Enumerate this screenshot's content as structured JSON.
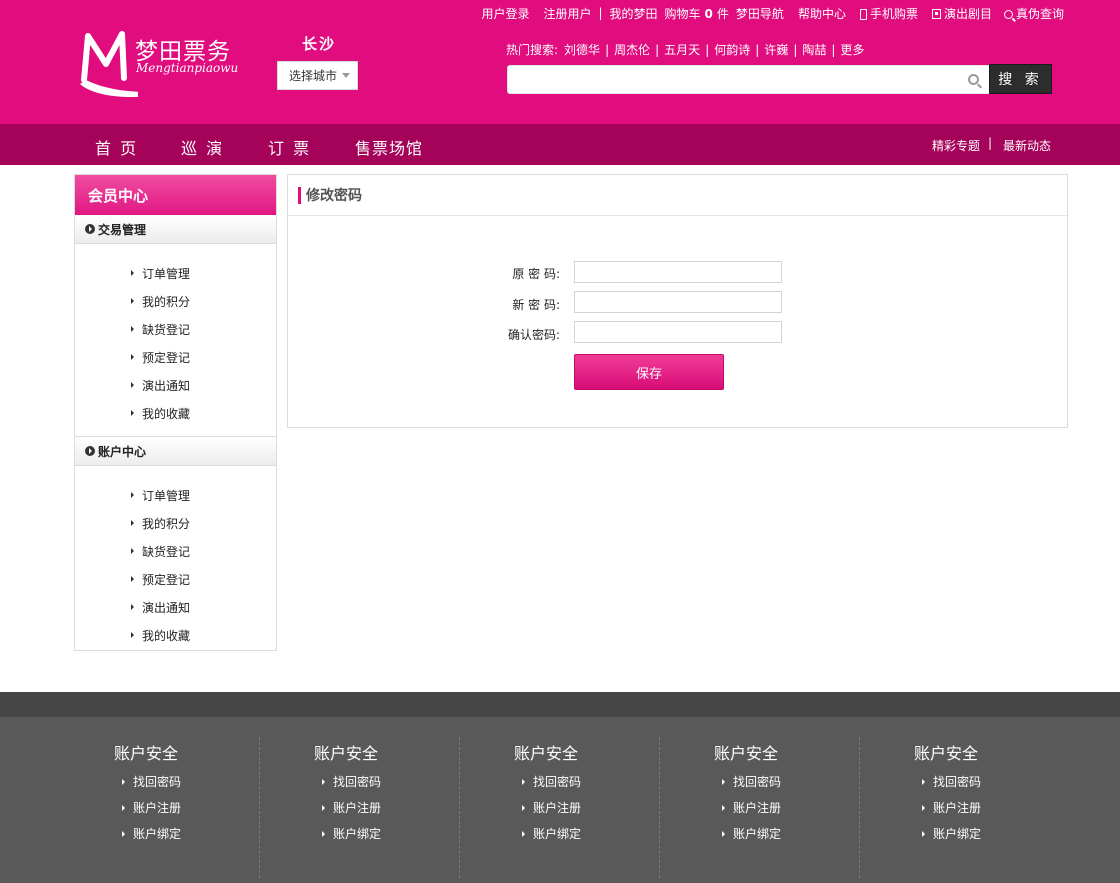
{
  "topnav": {
    "login": "用户登录",
    "register": "注册用户",
    "sep": "|",
    "my_account": "我的梦田",
    "cart_label": "购物车",
    "cart_count": "0",
    "cart_unit": "件",
    "site_nav": "梦田导航",
    "help": "帮助中心",
    "mobile": "手机购票",
    "repertoire": "演出剧目",
    "verify": "真伪查询"
  },
  "logo": {
    "cn": "梦田票务",
    "en": "Mengtianpiaowu"
  },
  "city": {
    "name": "长沙",
    "select_label": "选择城市"
  },
  "hot_search": {
    "label": "热门搜索:",
    "items": [
      "刘德华",
      "周杰伦",
      "五月天",
      "何韵诗",
      "许巍",
      "陶喆",
      "更多"
    ]
  },
  "search": {
    "placeholder": "",
    "button_label": "搜 索"
  },
  "mainnav": {
    "items": [
      "首 页",
      "巡 演",
      "订 票",
      "售票场馆"
    ],
    "right": [
      "精彩专题",
      "最新动态"
    ],
    "right_sep": "|"
  },
  "sidebar": {
    "title": "会员中心",
    "groups": [
      {
        "title": "交易管理",
        "items": [
          "订单管理",
          "我的积分",
          "缺货登记",
          "预定登记",
          "演出通知",
          "我的收藏"
        ]
      },
      {
        "title": "账户中心",
        "items": [
          "订单管理",
          "我的积分",
          "缺货登记",
          "预定登记",
          "演出通知",
          "我的收藏"
        ]
      }
    ]
  },
  "panel": {
    "title": "修改密码",
    "fields": [
      {
        "label": "原 密 码:",
        "value": ""
      },
      {
        "label": "新 密 码:",
        "value": ""
      },
      {
        "label": "确认密码:",
        "value": ""
      }
    ],
    "save_label": "保存"
  },
  "footer": {
    "columns": [
      {
        "title": "账户安全",
        "links": [
          "找回密码",
          "账户注册",
          "账户绑定"
        ]
      },
      {
        "title": "账户安全",
        "links": [
          "找回密码",
          "账户注册",
          "账户绑定"
        ]
      },
      {
        "title": "账户安全",
        "links": [
          "找回密码",
          "账户注册",
          "账户绑定"
        ]
      },
      {
        "title": "账户安全",
        "links": [
          "找回密码",
          "账户注册",
          "账户绑定"
        ]
      },
      {
        "title": "账户安全",
        "links": [
          "找回密码",
          "账户注册",
          "账户绑定"
        ]
      }
    ]
  },
  "colors": {
    "brand": "#e10c7e",
    "nav": "#a5025a",
    "search_button": "#2d2d2d",
    "footer": "#595959",
    "footer_strip": "#464646"
  },
  "icons": [
    "logo-m-icon",
    "phone-icon",
    "pages-icon",
    "magnifier-icon",
    "search-icon",
    "dropdown-caret-icon",
    "circle-arrow-icon",
    "bullet-arrow-icon"
  ]
}
